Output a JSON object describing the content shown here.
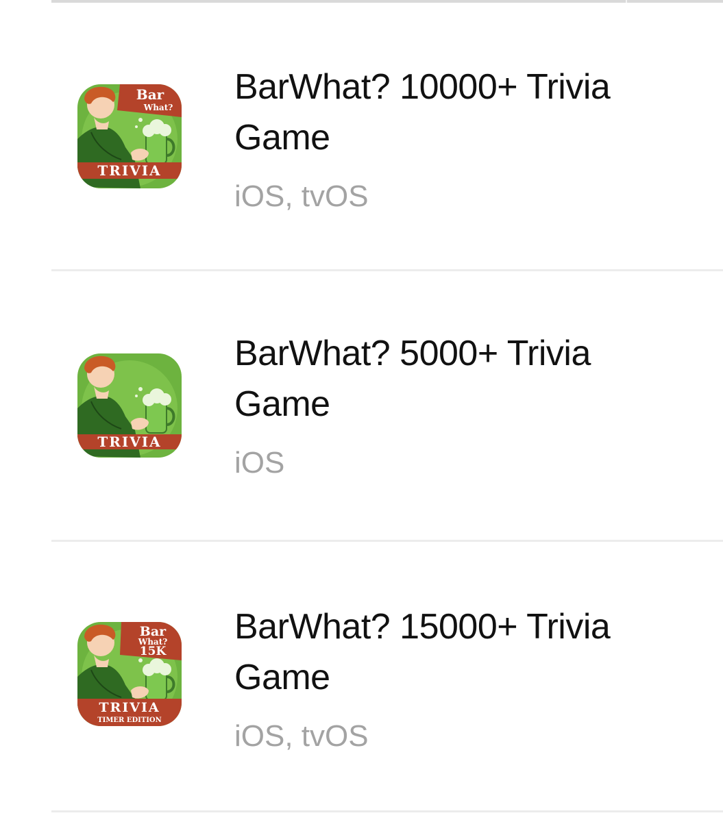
{
  "apps": [
    {
      "title": "BarWhat? 10000+ Trivia Game",
      "platforms": "iOS, tvOS",
      "icon": {
        "name": "barwhat-trivia-icon",
        "banner_top": "Bar",
        "banner_sub": "What?",
        "banner_bottom": "TRIVIA",
        "colors": {
          "background": "#6db33f",
          "banner": "#b4432a",
          "beer": "#7ec850"
        }
      }
    },
    {
      "title": "BarWhat? 5000+ Trivia Game",
      "platforms": "iOS",
      "icon": {
        "name": "barwhat-trivia-icon",
        "banner_top": "",
        "banner_sub": "",
        "banner_bottom": "TRIVIA",
        "colors": {
          "background": "#6db33f",
          "banner": "#b4432a",
          "beer": "#7ec850"
        }
      }
    },
    {
      "title": "BarWhat? 15000+ Trivia Game",
      "platforms": "iOS, tvOS",
      "icon": {
        "name": "barwhat-trivia-icon",
        "banner_top": "Bar",
        "banner_sub": "What?",
        "banner_extra": "15K",
        "banner_bottom": "TRIVIA",
        "banner_footer": "TIMER EDITION",
        "colors": {
          "background": "#6db33f",
          "banner": "#b4432a",
          "beer": "#7ec850"
        }
      }
    }
  ]
}
